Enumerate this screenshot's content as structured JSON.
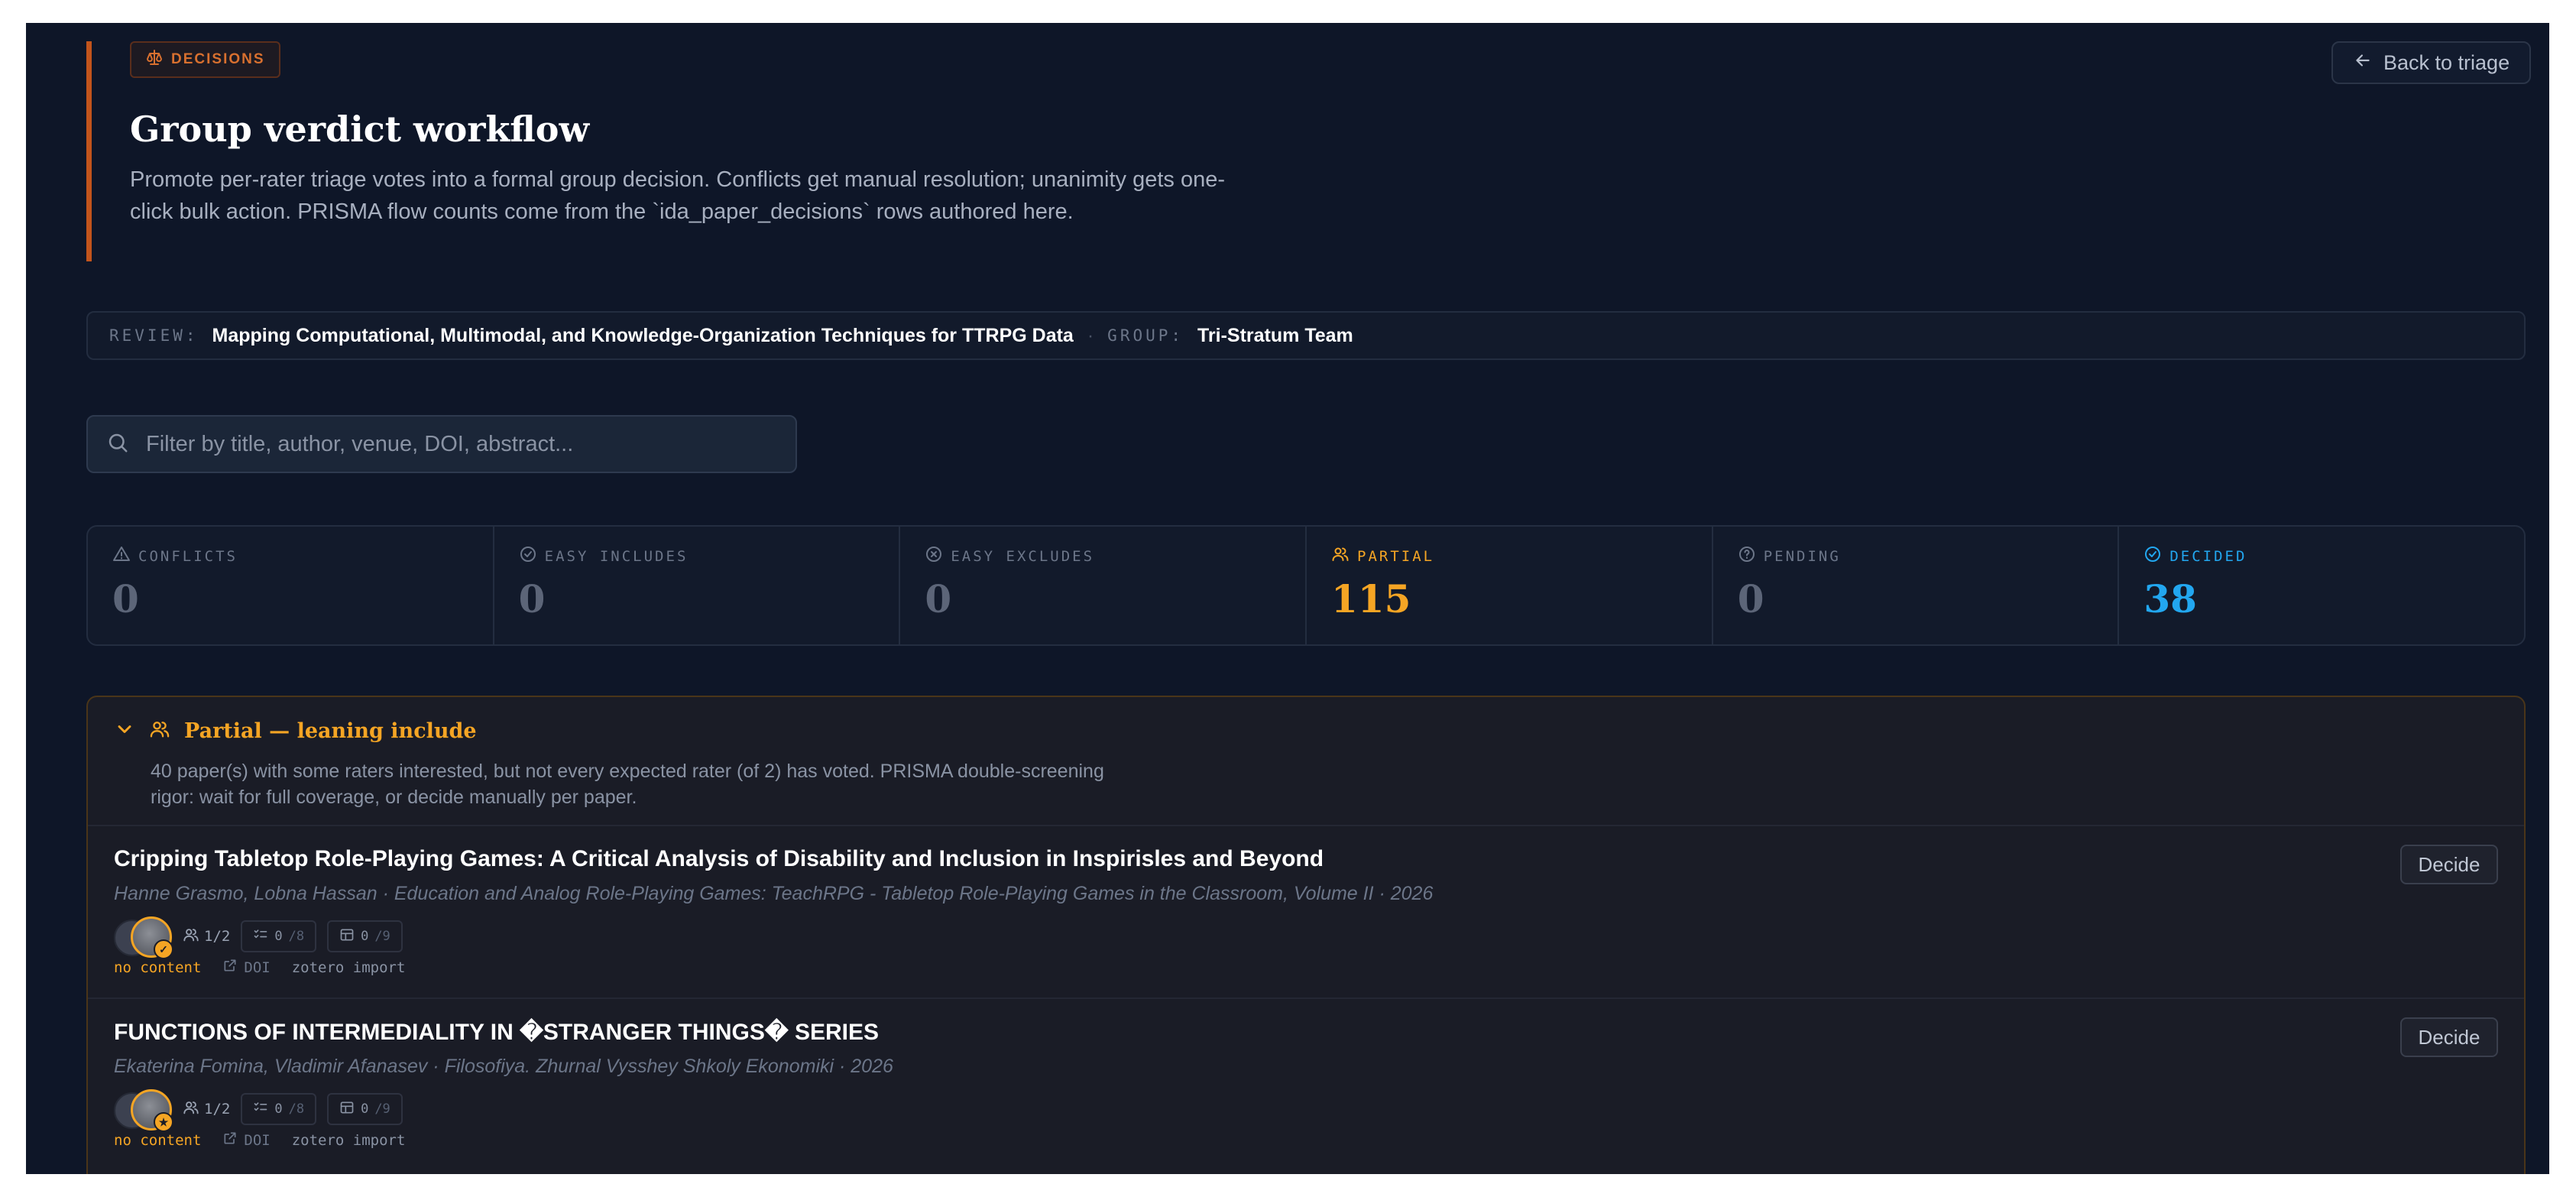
{
  "colors": {
    "background": "#0e1628",
    "accent": "#c2541c",
    "partial": "#f5a524",
    "decided": "#22a7f0"
  },
  "header": {
    "tag_label": "DECISIONS",
    "tag_icon": "scale-icon",
    "title": "Group verdict workflow",
    "subtitle": "Promote per-rater triage votes into a formal group decision. Conflicts get manual resolution; unanimity gets one-click bulk action. PRISMA flow counts come from the `ida_paper_decisions` rows authored here.",
    "back_button": "Back to triage"
  },
  "context": {
    "review_label": "REVIEW:",
    "review_value": "Mapping Computational, Multimodal, and Knowledge-Organization Techniques for TTRPG Data",
    "separator": "·",
    "group_label": "GROUP:",
    "group_value": "Tri-Stratum Team"
  },
  "search": {
    "placeholder": "Filter by title, author, venue, DOI, abstract..."
  },
  "stats": [
    {
      "label": "CONFLICTS",
      "value": "0",
      "icon": "warning-icon",
      "color": "#6c7689"
    },
    {
      "label": "EASY INCLUDES",
      "value": "0",
      "icon": "check-circle-icon",
      "color": "#6c7689"
    },
    {
      "label": "EASY EXCLUDES",
      "value": "0",
      "icon": "x-circle-icon",
      "color": "#6c7689"
    },
    {
      "label": "PARTIAL",
      "value": "115",
      "icon": "users-icon",
      "color": "#f5a524"
    },
    {
      "label": "PENDING",
      "value": "0",
      "icon": "question-circle-icon",
      "color": "#6c7689"
    },
    {
      "label": "DECIDED",
      "value": "38",
      "icon": "check-circle-icon",
      "color": "#22a7f0"
    }
  ],
  "section": {
    "title": "Partial — leaning include",
    "description": "40 paper(s) with some raters interested, but not every expected rater (of 2) has voted. PRISMA double-screening rigor: wait for full coverage, or decide manually per paper.",
    "papers": [
      {
        "title": "Cripping Tabletop Role-Playing Games: A Critical Analysis of Disability and Inclusion in Inspirisles and Beyond",
        "meta": "Hanne Grasmo, Lobna Hassan · Education and Analog Role-Playing Games: TeachRPG - Tabletop Role-Playing Games in the Classroom, Volume II · 2026",
        "voters": "1/2",
        "vote_badge": "✓",
        "criteria": "0",
        "criteria_total": "/8",
        "extraction": "0",
        "extraction_total": "/9",
        "status": "no content",
        "doi": "DOI",
        "source": "zotero import",
        "decide": "Decide"
      },
      {
        "title": "FUNCTIONS OF INTERMEDIALITY IN �STRANGER THINGS� SERIES",
        "meta": "Ekaterina Fomina, Vladimir Afanasev · Filosofiya. Zhurnal Vysshey Shkoly Ekonomiki · 2026",
        "voters": "1/2",
        "vote_badge": "★",
        "criteria": "0",
        "criteria_total": "/8",
        "extraction": "0",
        "extraction_total": "/9",
        "status": "no content",
        "doi": "DOI",
        "source": "zotero import",
        "decide": "Decide"
      }
    ]
  }
}
